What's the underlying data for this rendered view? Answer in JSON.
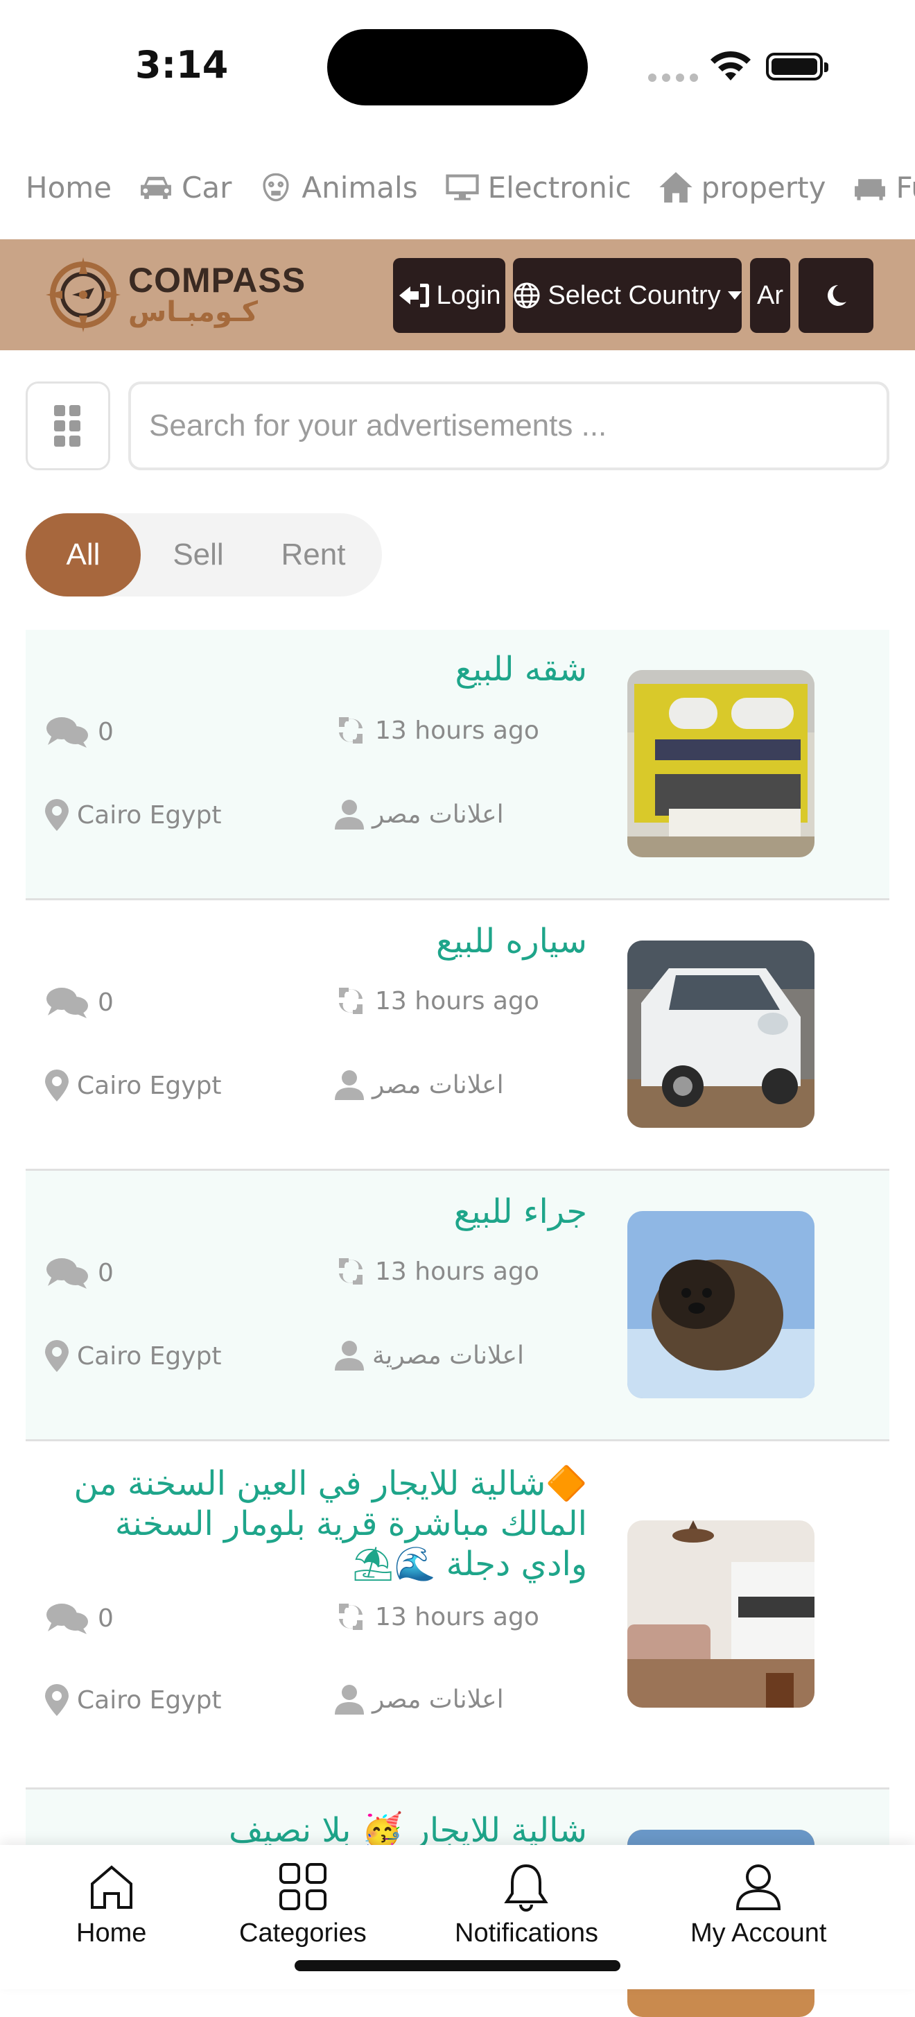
{
  "status_bar": {
    "time": "3:14"
  },
  "categories": [
    {
      "label": "Home",
      "icon": "none"
    },
    {
      "label": "Car",
      "icon": "car-icon"
    },
    {
      "label": "Animals",
      "icon": "animal-icon"
    },
    {
      "label": "Electronic",
      "icon": "monitor-icon"
    },
    {
      "label": "property",
      "icon": "house-icon"
    },
    {
      "label": "Fur",
      "icon": "sofa-icon"
    }
  ],
  "header": {
    "brand_en": "COMPASS",
    "brand_ar": "كـومبـاس",
    "login_label": "Login",
    "country_label": "Select Country",
    "lang_label": "Ar",
    "dark_mode_icon": "moon-icon",
    "colors": {
      "bar": "#c9a487",
      "buttons": "#2b1d1d"
    }
  },
  "search": {
    "placeholder": "Search for your advertisements ...",
    "value": ""
  },
  "tabs": [
    {
      "label": "All",
      "active": true
    },
    {
      "label": "Sell",
      "active": false
    },
    {
      "label": "Rent",
      "active": false
    }
  ],
  "listings": [
    {
      "title": "شقه للبيع",
      "comments": "0",
      "time": "13 hours ago",
      "location": "Cairo Egypt",
      "author": "اعلانات مصر"
    },
    {
      "title": "سياره للبيع",
      "comments": "0",
      "time": "13 hours ago",
      "location": "Cairo Egypt",
      "author": "اعلانات مصر"
    },
    {
      "title": "جراء للبيع",
      "comments": "0",
      "time": "13 hours ago",
      "location": "Cairo Egypt",
      "author": "اعلانات مصرية"
    },
    {
      "title": "🔶شالية للايجار في العين السخنة من المالك مباشرة قرية بلومار السخنة وادي دجلة 🌊⛱",
      "comments": "0",
      "time": "13 hours ago",
      "location": "Cairo Egypt",
      "author": "اعلانات مصر"
    },
    {
      "title": "شالية للايجار 🥳 بلا نصيف"
    }
  ],
  "bottom_nav": [
    {
      "label": "Home",
      "icon": "home-icon"
    },
    {
      "label": "Categories",
      "icon": "grid-icon"
    },
    {
      "label": "Notifications",
      "icon": "bell-icon"
    },
    {
      "label": "My Account",
      "icon": "user-icon"
    }
  ],
  "accent_colors": {
    "tab_active": "#a7673d",
    "listing_title": "#1ea58a",
    "listing_alt_bg": "#f4fbf9"
  }
}
